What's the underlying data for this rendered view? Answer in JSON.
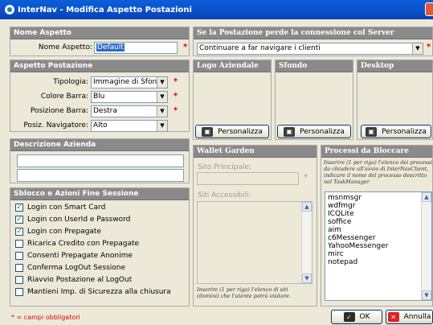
{
  "window": {
    "title": "InterNav - Modifica Aspetto Postazioni"
  },
  "nome_aspetto": {
    "header": "Nome Aspetto",
    "label": "Nome Aspetto:",
    "value": "Default"
  },
  "connessione": {
    "header": "Se la Postazione perde la connessione col Server",
    "value": "Continuare a far navigare i clienti"
  },
  "aspetto_postazione": {
    "header": "Aspetto Postazione",
    "fields": [
      {
        "label": "Tipologia:",
        "value": "Immagine di Sfondo"
      },
      {
        "label": "Colore Barra:",
        "value": "Blu"
      },
      {
        "label": "Posizione Barra:",
        "value": "Destra"
      },
      {
        "label": "Posiz. Navigatore:",
        "value": "Alto"
      }
    ]
  },
  "images": {
    "logo": {
      "header": "Logo Aziendale",
      "button": "Personalizza"
    },
    "sfondo": {
      "header": "Sfondo",
      "button": "Personalizza"
    },
    "desktop": {
      "header": "Desktop",
      "button": "Personalizza"
    }
  },
  "descrizione": {
    "header": "Descrizione Azienda",
    "line1": "",
    "line2": ""
  },
  "sblocco": {
    "header": "Sblocco e Azioni Fine Sessione",
    "items": [
      {
        "label": "Login con Smart Card",
        "checked": true
      },
      {
        "label": "Login con UserId e Password",
        "checked": true
      },
      {
        "label": "Login con Prepagate",
        "checked": true
      },
      {
        "label": "Ricarica Credito con Prepagate",
        "checked": false
      },
      {
        "label": "Consenti Prepagate Anonime",
        "checked": false
      },
      {
        "label": "Conferma LogOut Sessione",
        "checked": false
      },
      {
        "label": "Riavvio Postazione al LogOut",
        "checked": false
      },
      {
        "label": "Mantieni Imp. di Sicurezza alla chiusura",
        "checked": false
      }
    ]
  },
  "wallet": {
    "header": "Wallet Garden",
    "sito_label": "Sito Principale:",
    "siti_label": "Siti Accessibili:",
    "hint": "Inserire (1 per riga) l'elenco di siti (domini) che l'utente potrà visitare."
  },
  "processi": {
    "header": "Processi da Bloccare",
    "hint": "Inserire (1 per riga) l'elenco dei processi da chiudere all'avvio di InterNavClient, indicare il nome del processo descritto nel TaskManager",
    "list": [
      "msnmsgr",
      "wdfmgr",
      "ICQLite",
      "soffice",
      "aim",
      "c6Messenger",
      "YahooMessenger",
      "mirc",
      "notepad"
    ]
  },
  "footer": {
    "required_note": "* = campi obbligatori",
    "ok": "OK",
    "cancel": "Annulla"
  },
  "colors": {
    "title": "#0a4fc8",
    "header": "#8a8a8a",
    "required": "#e00000",
    "check": "#1e8b1e"
  }
}
